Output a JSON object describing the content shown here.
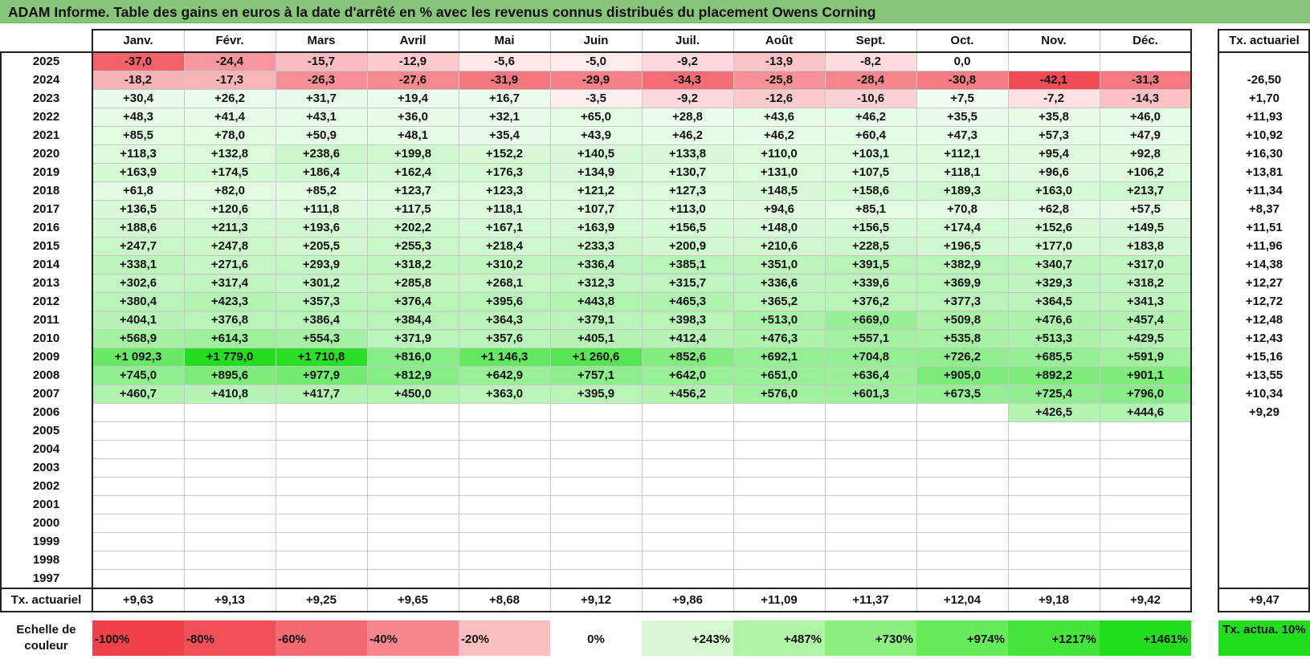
{
  "title": "ADAM Informe. Table des gains en euros à la date d'arrêté en % avec les revenus connus distribués du placement Owens Corning",
  "chart_data": {
    "type": "heatmap",
    "columns": [
      "Janv.",
      "Févr.",
      "Mars",
      "Avril",
      "Mai",
      "Juin",
      "Juil.",
      "Août",
      "Sept.",
      "Oct.",
      "Nov.",
      "Déc."
    ],
    "rate_header": "Tx. actuariel",
    "rows": [
      {
        "year": "2025",
        "values": [
          "-37,0",
          "-24,4",
          "-15,7",
          "-12,9",
          "-5,6",
          "-5,0",
          "-9,2",
          "-13,9",
          "-8,2",
          "0,0",
          "",
          ""
        ],
        "rate": ""
      },
      {
        "year": "2024",
        "values": [
          "-18,2",
          "-17,3",
          "-26,3",
          "-27,6",
          "-31,9",
          "-29,9",
          "-34,3",
          "-25,8",
          "-28,4",
          "-30,8",
          "-42,1",
          "-31,3"
        ],
        "rate": "-26,50"
      },
      {
        "year": "2023",
        "values": [
          "+30,4",
          "+26,2",
          "+31,7",
          "+19,4",
          "+16,7",
          "-3,5",
          "-9,2",
          "-12,6",
          "-10,6",
          "+7,5",
          "-7,2",
          "-14,3"
        ],
        "rate": "+1,70"
      },
      {
        "year": "2022",
        "values": [
          "+48,3",
          "+41,4",
          "+43,1",
          "+36,0",
          "+32,1",
          "+65,0",
          "+28,8",
          "+43,6",
          "+46,2",
          "+35,5",
          "+35,8",
          "+46,0"
        ],
        "rate": "+11,93"
      },
      {
        "year": "2021",
        "values": [
          "+85,5",
          "+78,0",
          "+50,9",
          "+48,1",
          "+35,4",
          "+43,9",
          "+46,2",
          "+46,2",
          "+60,4",
          "+47,3",
          "+57,3",
          "+47,9"
        ],
        "rate": "+10,92"
      },
      {
        "year": "2020",
        "values": [
          "+118,3",
          "+132,8",
          "+238,6",
          "+199,8",
          "+152,2",
          "+140,5",
          "+133,8",
          "+110,0",
          "+103,1",
          "+112,1",
          "+95,4",
          "+92,8"
        ],
        "rate": "+16,30"
      },
      {
        "year": "2019",
        "values": [
          "+163,9",
          "+174,5",
          "+186,4",
          "+162,4",
          "+176,3",
          "+134,9",
          "+130,7",
          "+131,0",
          "+107,5",
          "+118,1",
          "+96,6",
          "+106,2"
        ],
        "rate": "+13,81"
      },
      {
        "year": "2018",
        "values": [
          "+61,8",
          "+82,0",
          "+85,2",
          "+123,7",
          "+123,3",
          "+121,2",
          "+127,3",
          "+148,5",
          "+158,6",
          "+189,3",
          "+163,0",
          "+213,7"
        ],
        "rate": "+11,34"
      },
      {
        "year": "2017",
        "values": [
          "+136,5",
          "+120,6",
          "+111,8",
          "+117,5",
          "+118,1",
          "+107,7",
          "+113,0",
          "+94,6",
          "+85,1",
          "+70,8",
          "+62,8",
          "+57,5"
        ],
        "rate": "+8,37"
      },
      {
        "year": "2016",
        "values": [
          "+188,6",
          "+211,3",
          "+193,6",
          "+202,2",
          "+167,1",
          "+163,9",
          "+156,5",
          "+148,0",
          "+156,5",
          "+174,4",
          "+152,6",
          "+149,5"
        ],
        "rate": "+11,51"
      },
      {
        "year": "2015",
        "values": [
          "+247,7",
          "+247,8",
          "+205,5",
          "+255,3",
          "+218,4",
          "+233,3",
          "+200,9",
          "+210,6",
          "+228,5",
          "+196,5",
          "+177,0",
          "+183,8"
        ],
        "rate": "+11,96"
      },
      {
        "year": "2014",
        "values": [
          "+338,1",
          "+271,6",
          "+293,9",
          "+318,2",
          "+310,2",
          "+336,4",
          "+385,1",
          "+351,0",
          "+391,5",
          "+382,9",
          "+340,7",
          "+317,0"
        ],
        "rate": "+14,38"
      },
      {
        "year": "2013",
        "values": [
          "+302,6",
          "+317,4",
          "+301,2",
          "+285,8",
          "+268,1",
          "+312,3",
          "+315,7",
          "+336,6",
          "+339,6",
          "+369,9",
          "+329,3",
          "+318,2"
        ],
        "rate": "+12,27"
      },
      {
        "year": "2012",
        "values": [
          "+380,4",
          "+423,3",
          "+357,3",
          "+376,4",
          "+395,6",
          "+443,8",
          "+465,3",
          "+365,2",
          "+376,2",
          "+377,3",
          "+364,5",
          "+341,3"
        ],
        "rate": "+12,72"
      },
      {
        "year": "2011",
        "values": [
          "+404,1",
          "+376,8",
          "+386,4",
          "+384,4",
          "+364,3",
          "+379,1",
          "+398,3",
          "+513,0",
          "+669,0",
          "+509,8",
          "+476,6",
          "+457,4"
        ],
        "rate": "+12,48"
      },
      {
        "year": "2010",
        "values": [
          "+568,9",
          "+614,3",
          "+554,3",
          "+371,9",
          "+357,6",
          "+405,1",
          "+412,4",
          "+476,3",
          "+557,1",
          "+535,8",
          "+513,3",
          "+429,5"
        ],
        "rate": "+12,43"
      },
      {
        "year": "2009",
        "values": [
          "+1 092,3",
          "+1 779,0",
          "+1 710,8",
          "+816,0",
          "+1 146,3",
          "+1 260,6",
          "+852,6",
          "+692,1",
          "+704,8",
          "+726,2",
          "+685,5",
          "+591,9"
        ],
        "rate": "+15,16"
      },
      {
        "year": "2008",
        "values": [
          "+745,0",
          "+895,6",
          "+977,9",
          "+812,9",
          "+642,9",
          "+757,1",
          "+642,0",
          "+651,0",
          "+636,4",
          "+905,0",
          "+892,2",
          "+901,1"
        ],
        "rate": "+13,55"
      },
      {
        "year": "2007",
        "values": [
          "+460,7",
          "+410,8",
          "+417,7",
          "+450,0",
          "+363,0",
          "+395,9",
          "+456,2",
          "+576,0",
          "+601,3",
          "+673,5",
          "+725,4",
          "+796,0"
        ],
        "rate": "+10,34"
      },
      {
        "year": "2006",
        "values": [
          "",
          "",
          "",
          "",
          "",
          "",
          "",
          "",
          "",
          "",
          "+426,5",
          "+444,6"
        ],
        "rate": "+9,29"
      },
      {
        "year": "2005",
        "values": [
          "",
          "",
          "",
          "",
          "",
          "",
          "",
          "",
          "",
          "",
          "",
          ""
        ],
        "rate": ""
      },
      {
        "year": "2004",
        "values": [
          "",
          "",
          "",
          "",
          "",
          "",
          "",
          "",
          "",
          "",
          "",
          ""
        ],
        "rate": ""
      },
      {
        "year": "2003",
        "values": [
          "",
          "",
          "",
          "",
          "",
          "",
          "",
          "",
          "",
          "",
          "",
          ""
        ],
        "rate": ""
      },
      {
        "year": "2002",
        "values": [
          "",
          "",
          "",
          "",
          "",
          "",
          "",
          "",
          "",
          "",
          "",
          ""
        ],
        "rate": ""
      },
      {
        "year": "2001",
        "values": [
          "",
          "",
          "",
          "",
          "",
          "",
          "",
          "",
          "",
          "",
          "",
          ""
        ],
        "rate": ""
      },
      {
        "year": "2000",
        "values": [
          "",
          "",
          "",
          "",
          "",
          "",
          "",
          "",
          "",
          "",
          "",
          ""
        ],
        "rate": ""
      },
      {
        "year": "1999",
        "values": [
          "",
          "",
          "",
          "",
          "",
          "",
          "",
          "",
          "",
          "",
          "",
          ""
        ],
        "rate": ""
      },
      {
        "year": "1998",
        "values": [
          "",
          "",
          "",
          "",
          "",
          "",
          "",
          "",
          "",
          "",
          "",
          ""
        ],
        "rate": ""
      },
      {
        "year": "1997",
        "values": [
          "",
          "",
          "",
          "",
          "",
          "",
          "",
          "",
          "",
          "",
          "",
          ""
        ],
        "rate": ""
      }
    ],
    "footer": {
      "label": "Tx. actuariel",
      "values": [
        "+9,63",
        "+9,13",
        "+9,25",
        "+9,65",
        "+8,68",
        "+9,12",
        "+9,86",
        "+11,09",
        "+11,37",
        "+12,04",
        "+9,18",
        "+9,42"
      ],
      "rate": "+9,47"
    },
    "scale": {
      "label": "Echelle de couleur",
      "stops": [
        {
          "label": "-100%",
          "color": "#f0404a",
          "align": "left"
        },
        {
          "label": "-80%",
          "color": "#f25058",
          "align": "left"
        },
        {
          "label": "-60%",
          "color": "#f56a70",
          "align": "left"
        },
        {
          "label": "-40%",
          "color": "#f7878c",
          "align": "left"
        },
        {
          "label": "-20%",
          "color": "#fbbfc2",
          "align": "left"
        },
        {
          "label": "0%",
          "color": "#ffffff",
          "align": "center"
        },
        {
          "label": "+243%",
          "color": "#d7f9d2",
          "align": "right"
        },
        {
          "label": "+487%",
          "color": "#b0f4a6",
          "align": "right"
        },
        {
          "label": "+730%",
          "color": "#8bf07f",
          "align": "right"
        },
        {
          "label": "+974%",
          "color": "#66ec5a",
          "align": "right"
        },
        {
          "label": "+1217%",
          "color": "#44e43c",
          "align": "right"
        },
        {
          "label": "+1461%",
          "color": "#22dd1e",
          "align": "right"
        }
      ],
      "rate_label": "Tx. actua. 10%",
      "rate_color": "#22dd1e"
    }
  }
}
